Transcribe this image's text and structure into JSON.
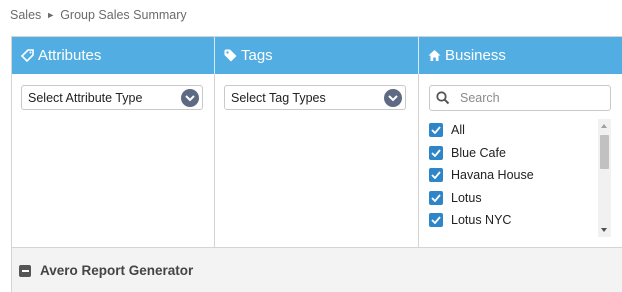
{
  "breadcrumb": {
    "parent": "Sales",
    "separator": "►",
    "current": "Group Sales Summary"
  },
  "columns": {
    "attributes": {
      "title": "Attributes",
      "icon": "tag-pencil-icon",
      "select_value": "Select Attribute Type"
    },
    "tags": {
      "title": "Tags",
      "icon": "tag-icon",
      "select_value": "Select Tag Types"
    },
    "business": {
      "title": "Business",
      "icon": "home-icon",
      "search_placeholder": "Search",
      "items": [
        {
          "label": "All",
          "checked": true
        },
        {
          "label": "Blue Cafe",
          "checked": true
        },
        {
          "label": "Havana House",
          "checked": true
        },
        {
          "label": "Lotus",
          "checked": true
        },
        {
          "label": "Lotus NYC",
          "checked": true
        }
      ]
    }
  },
  "footer": {
    "title": "Avero Report Generator",
    "icon": "minus-square-icon"
  },
  "colors": {
    "header_bg": "#52aee2",
    "checkbox": "#2e86c8",
    "caret_bg": "#5e6a84"
  }
}
